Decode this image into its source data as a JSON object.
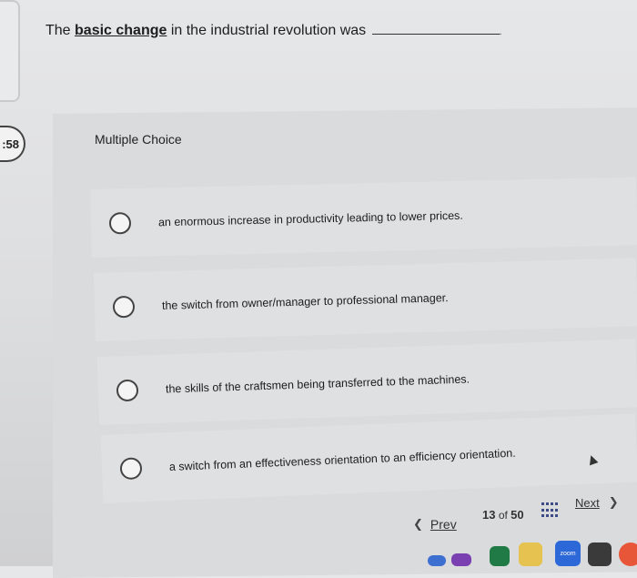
{
  "question": {
    "prefix": "The ",
    "emphasis": "basic change",
    "suffix": " in the industrial revolution was",
    "end_mark": "."
  },
  "timer": {
    "text": ":58"
  },
  "multiple_choice": {
    "heading": "Multiple Choice",
    "options": [
      {
        "label": "an enormous increase in productivity leading to lower prices."
      },
      {
        "label": "the switch from owner/manager to professional manager."
      },
      {
        "label": "the skills of the craftsmen being transferred to the machines."
      },
      {
        "label": "a switch from an effectiveness orientation to an efficiency orientation."
      }
    ]
  },
  "navigation": {
    "prev_label": "Prev",
    "current_page": "13",
    "of_text": "of",
    "total_pages": "50",
    "next_label": "Next"
  },
  "dock": {
    "zoom_label": "zoom"
  },
  "colors": {
    "accent": "#3c4a86",
    "background": "#dfe0e2"
  }
}
